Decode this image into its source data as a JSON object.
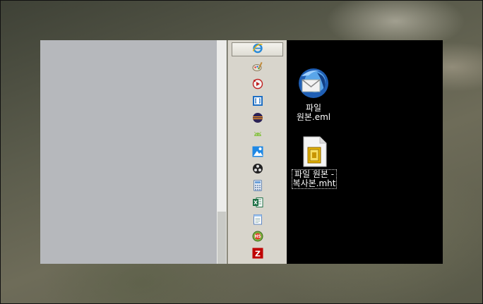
{
  "desktop": {
    "files": [
      {
        "icon": "thunderbird-mail-icon",
        "line1": "파일",
        "line2": "원본.eml"
      },
      {
        "icon": "mht-document-icon",
        "line1": "파일 원본 -",
        "line2": "복사본.mht"
      }
    ]
  },
  "launcher": {
    "top_button_icon": "internet-explorer-icon",
    "items": [
      "paint-icon",
      "media-player-icon",
      "bracket-editor-icon",
      "eclipse-icon",
      "android-icon",
      "photo-editor-icon",
      "obs-icon",
      "calculator-icon",
      "excel-icon",
      "notepad-icon",
      "hs-icon",
      "filezilla-icon"
    ]
  },
  "colors": {
    "desktop_bg": "#000000",
    "launcher_bg": "#d8d5cc",
    "left_pane_bg": "#b6b8bc"
  }
}
